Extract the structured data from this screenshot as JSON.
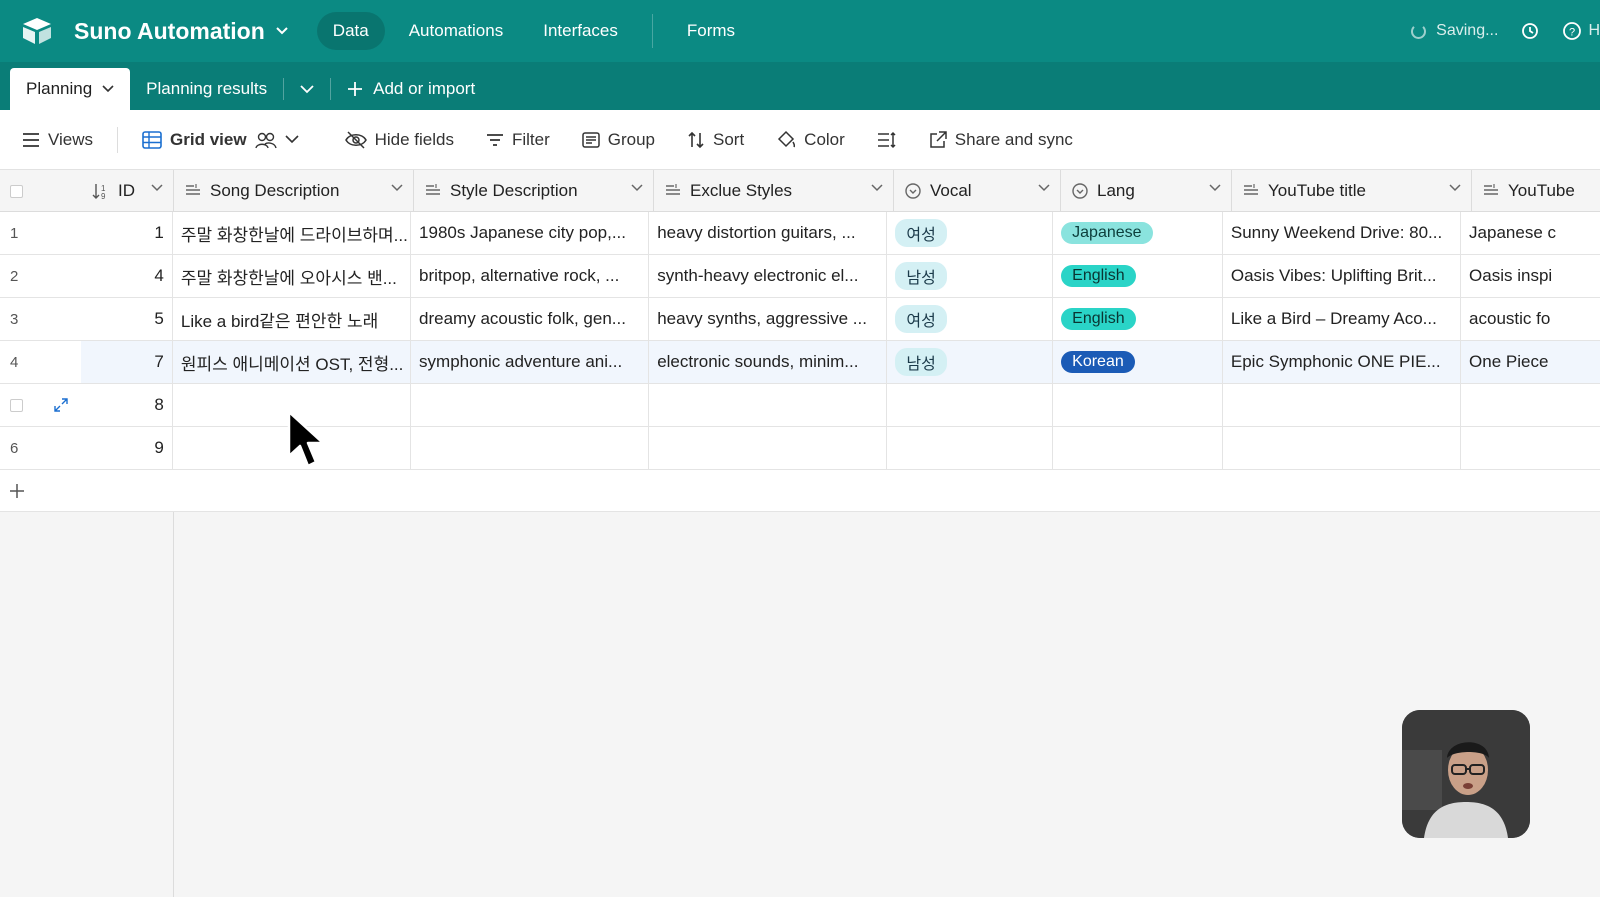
{
  "app": {
    "base_name": "Suno Automation",
    "nav": [
      "Data",
      "Automations",
      "Interfaces",
      "Forms"
    ],
    "saving_label": "Saving...",
    "help_label": "H"
  },
  "tabs": {
    "active": "Planning",
    "other": "Planning results",
    "add_label": "Add or import"
  },
  "toolbar": {
    "views": "Views",
    "grid_view": "Grid view",
    "hide_fields": "Hide fields",
    "filter": "Filter",
    "group": "Group",
    "sort": "Sort",
    "color": "Color",
    "share": "Share and sync"
  },
  "columns": {
    "id": "ID",
    "song": "Song Description",
    "style": "Style Description",
    "excl": "Exclue Styles",
    "vocal": "Vocal",
    "lang": "Lang",
    "yt": "YouTube title",
    "yt2": "YouTube"
  },
  "rows": [
    {
      "num": "1",
      "id": "1",
      "song": "주말 화창한날에 드라이브하며...",
      "style": "1980s Japanese city pop,...",
      "excl": "heavy distortion guitars, ...",
      "vocal": "여성",
      "lang": "Japanese",
      "yt": "Sunny Weekend Drive: 80...",
      "yt2": "Japanese c"
    },
    {
      "num": "2",
      "id": "4",
      "song": "주말 화창한날에 오아시스 밴...",
      "style": "britpop, alternative rock, ...",
      "excl": "synth-heavy electronic el...",
      "vocal": "남성",
      "lang": "English",
      "yt": "Oasis Vibes: Uplifting Brit...",
      "yt2": "Oasis inspi"
    },
    {
      "num": "3",
      "id": "5",
      "song": "Like a bird같은 편안한 노래",
      "style": "dreamy acoustic folk, gen...",
      "excl": "heavy synths, aggressive ...",
      "vocal": "여성",
      "lang": "English",
      "yt": "Like a Bird – Dreamy Aco...",
      "yt2": "acoustic fo"
    },
    {
      "num": "4",
      "id": "7",
      "song": "원피스 애니메이션 OST, 전형...",
      "style": "symphonic adventure ani...",
      "excl": "electronic sounds, minim...",
      "vocal": "남성",
      "lang": "Korean",
      "yt": "Epic Symphonic ONE PIE...",
      "yt2": "One Piece"
    }
  ],
  "empty_rows": [
    {
      "num": "",
      "id": "8"
    },
    {
      "num": "6",
      "id": "9"
    }
  ],
  "colors": {
    "brand": "#0b8a83",
    "tab_bar": "#0a7d77",
    "pill_korean": "#1b5bb6",
    "pill_english": "#2ad4c7",
    "pill_japanese": "#8ae3de"
  }
}
